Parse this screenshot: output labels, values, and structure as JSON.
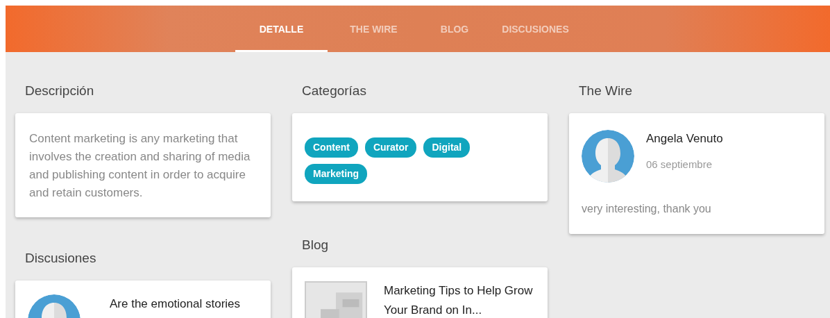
{
  "tabs": [
    {
      "label": "DETALLE",
      "selected": true
    },
    {
      "label": "THE WIRE",
      "selected": false
    },
    {
      "label": "BLOG",
      "selected": false
    },
    {
      "label": "DISCUSIONES",
      "selected": false
    }
  ],
  "description": {
    "heading": "Descripción",
    "text": "Content marketing is any marketing that involves the creation and sharing of media and publishing content in order to acquire and retain customers."
  },
  "discussions": {
    "heading": "Discusiones",
    "items": [
      {
        "title": "Are the emotional stories"
      }
    ]
  },
  "categories": {
    "heading": "Categorías",
    "tags": [
      "Content",
      "Curator",
      "Digital",
      "Marketing"
    ]
  },
  "blog": {
    "heading": "Blog",
    "posts": [
      {
        "title": "Marketing Tips to Help Grow Your Brand on In..."
      }
    ]
  },
  "wire": {
    "heading": "The Wire",
    "posts": [
      {
        "author": "Angela Venuto",
        "date": "06 septiembre",
        "text": "very interesting, thank you"
      }
    ]
  }
}
